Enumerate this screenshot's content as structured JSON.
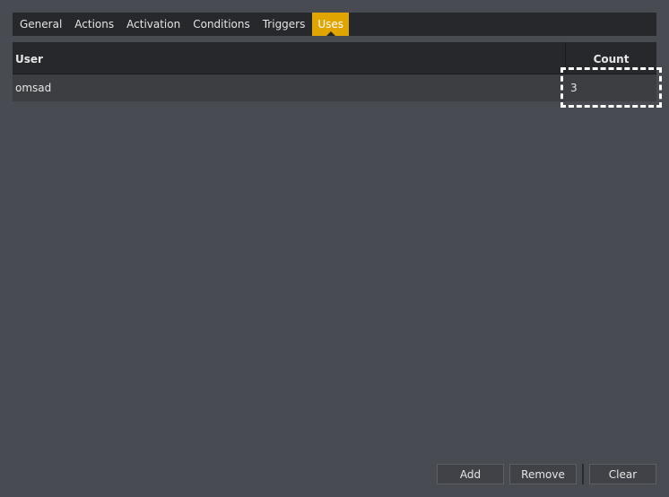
{
  "tabs": [
    {
      "label": "General",
      "active": false
    },
    {
      "label": "Actions",
      "active": false
    },
    {
      "label": "Activation",
      "active": false
    },
    {
      "label": "Conditions",
      "active": false
    },
    {
      "label": "Triggers",
      "active": false
    },
    {
      "label": "Uses",
      "active": true
    }
  ],
  "table": {
    "columns": {
      "user": "User",
      "count": "Count"
    },
    "rows": [
      {
        "user": "omsad",
        "count": "3"
      }
    ]
  },
  "buttons": {
    "add": "Add",
    "remove": "Remove",
    "clear": "Clear"
  },
  "colors": {
    "accent": "#e0a500",
    "background": "#484b51",
    "header": "#27282c",
    "row": "#3d3e42"
  }
}
